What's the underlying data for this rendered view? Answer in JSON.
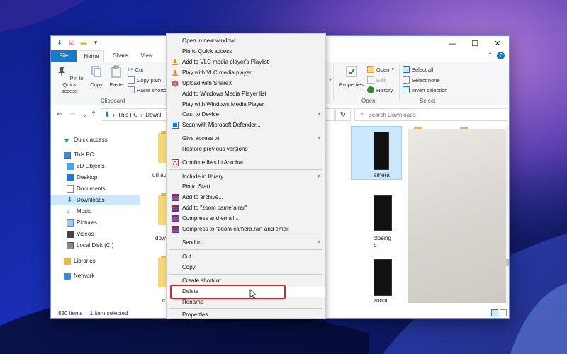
{
  "colors": {
    "accent": "#1979ca",
    "highlight": "#cce8ff",
    "delete_box": "#e01b2a",
    "wallpaper": "#1a2a8a"
  },
  "window": {
    "win_controls": [
      "—",
      "☐",
      "✕"
    ]
  },
  "ribbon": {
    "tabs": [
      "File",
      "Home",
      "Share",
      "View"
    ],
    "pin_label": "Pin to Quick access",
    "copy_label": "Copy",
    "paste_label": "Paste",
    "cut_label": "Cut",
    "copy_path_label": "Copy path",
    "paste_shortcut_label": "Paste shortc",
    "clipboard_group": "Clipboard",
    "properties_label": "Properties",
    "open_label": "Open",
    "edit_label": "Edit",
    "history_label": "History",
    "open_group": "Open",
    "select_all": "Select all",
    "select_none": "Select none",
    "invert_selection": "Invert selection",
    "select_group": "Select"
  },
  "address": {
    "back": "←",
    "forward": "→",
    "recent": "⌄",
    "up": "↑",
    "this_pc": "This PC",
    "sep": "›",
    "downloads_partial": "Downl",
    "refresh": "↻",
    "search_placeholder": "Search Downloads"
  },
  "navpane": {
    "items": [
      {
        "label": "Quick access",
        "icon": "star-icon"
      },
      {
        "label": "This PC",
        "icon": "pc-icon"
      },
      {
        "label": "3D Objects",
        "icon": "cube-icon"
      },
      {
        "label": "Desktop",
        "icon": "desktop-icon"
      },
      {
        "label": "Documents",
        "icon": "documents-icon"
      },
      {
        "label": "Downloads",
        "icon": "download-icon",
        "selected": true
      },
      {
        "label": "Music",
        "icon": "music-icon"
      },
      {
        "label": "Pictures",
        "icon": "pictures-icon"
      },
      {
        "label": "Videos",
        "icon": "videos-icon"
      },
      {
        "label": "Local Disk (C:)",
        "icon": "disk-icon"
      },
      {
        "label": "Libraries",
        "icon": "library-icon"
      },
      {
        "label": "Network",
        "icon": "network-icon"
      }
    ]
  },
  "content": {
    "labels": [
      "url au",
      "amera",
      "dow",
      "closing",
      "b",
      "c",
      "zoom"
    ]
  },
  "status": {
    "count": "820 items",
    "selected": "1 item selected"
  },
  "context_menu": {
    "items": [
      "Open in new window",
      "Pin to Quick access",
      "Add to VLC media player's Playlist",
      "Play with VLC media player",
      "Upload with ShareX",
      "Add to Windows Media Player list",
      "Play with Windows Media Player",
      "Cast to Device",
      "Scan with Microsoft Defender...",
      "Give access to",
      "Restore previous versions",
      "Combine files in Acrobat...",
      "Include in library",
      "Pin to Start",
      "Add to archive...",
      "Add to \"zoom camera.rar\"",
      "Compress and email...",
      "Compress to \"zoom camera.rar\" and email",
      "Send to",
      "Cut",
      "Copy",
      "Create shortcut",
      "Delete",
      "Rename",
      "Properties"
    ],
    "submenu_arrow": "›"
  }
}
